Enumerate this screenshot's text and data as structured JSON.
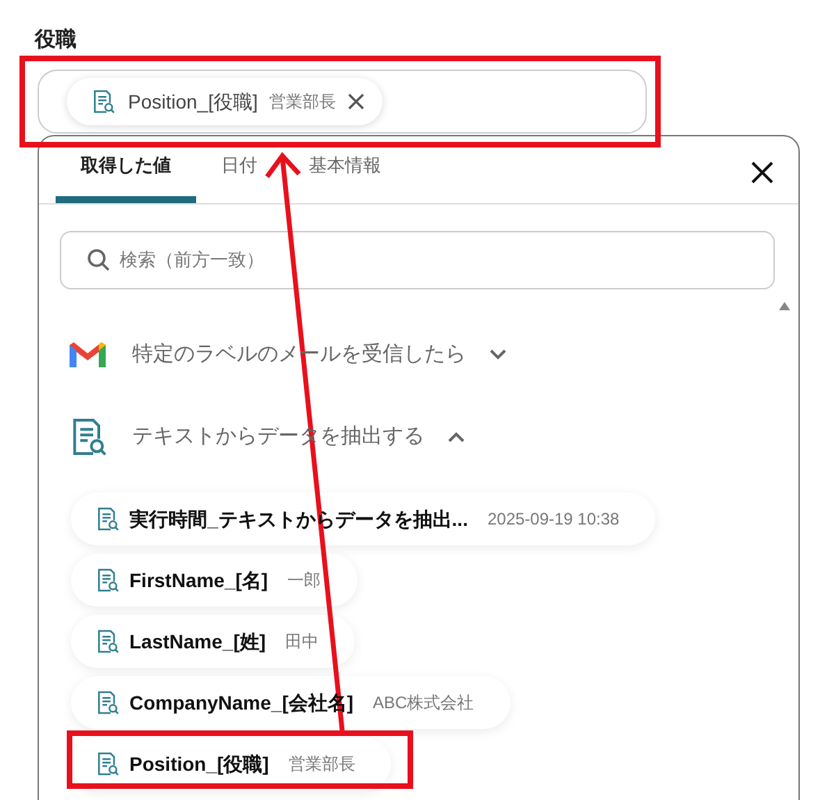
{
  "field": {
    "label": "役職",
    "chip": {
      "name": "Position_[役職]",
      "value": "営業部長"
    }
  },
  "panel": {
    "tabs": [
      {
        "label": "取得した値",
        "selected": true
      },
      {
        "label": "日付",
        "selected": false
      },
      {
        "label": "基本情報",
        "selected": false
      }
    ],
    "search": {
      "placeholder": "検索（前方一致）"
    },
    "groups": [
      {
        "kind": "gmail",
        "title": "特定のラベルのメールを受信したら",
        "expanded": false
      },
      {
        "kind": "extract",
        "title": "テキストからデータを抽出する",
        "expanded": true,
        "items": [
          {
            "name": "実行時間_テキストからデータを抽出...",
            "value": "2025-09-19 10:38"
          },
          {
            "name": "FirstName_[名]",
            "value": "一郎"
          },
          {
            "name": "LastName_[姓]",
            "value": "田中"
          },
          {
            "name": "CompanyName_[会社名]",
            "value": "ABC株式会社"
          },
          {
            "name": "Position_[役職]",
            "value": "営業部長"
          }
        ]
      }
    ]
  }
}
